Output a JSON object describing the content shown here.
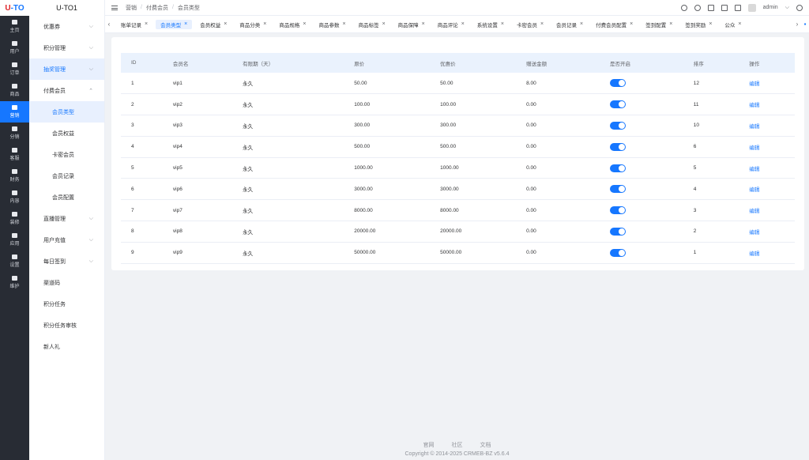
{
  "logo": {
    "part1": "U",
    "part2": "-",
    "part3": "TO"
  },
  "rail": [
    {
      "label": "主页",
      "icon": "home-icon"
    },
    {
      "label": "用户",
      "icon": "user-icon"
    },
    {
      "label": "订单",
      "icon": "order-icon"
    },
    {
      "label": "商品",
      "icon": "product-icon"
    },
    {
      "label": "营销",
      "icon": "marketing-icon",
      "active": true
    },
    {
      "label": "分销",
      "icon": "distribution-icon"
    },
    {
      "label": "客服",
      "icon": "service-icon"
    },
    {
      "label": "财务",
      "icon": "finance-icon"
    },
    {
      "label": "内容",
      "icon": "content-icon"
    },
    {
      "label": "装修",
      "icon": "decoration-icon"
    },
    {
      "label": "应用",
      "icon": "apps-icon"
    },
    {
      "label": "设置",
      "icon": "settings-icon"
    },
    {
      "label": "维护",
      "icon": "maintain-icon"
    }
  ],
  "app_title": "U-TO1",
  "submenu": [
    {
      "label": "优惠券",
      "arrow": "⌵"
    },
    {
      "label": "积分管理",
      "arrow": "⌵"
    },
    {
      "label": "抽奖管理",
      "arrow": "⌵",
      "hl": true
    },
    {
      "label": "付费会员",
      "arrow": "⌃"
    },
    {
      "label": "会员类型",
      "sub": true,
      "selected": true
    },
    {
      "label": "会员权益",
      "sub": true
    },
    {
      "label": "卡密会员",
      "sub": true
    },
    {
      "label": "会员记录",
      "sub": true
    },
    {
      "label": "会员配置",
      "sub": true
    },
    {
      "label": "直播管理",
      "arrow": "⌵"
    },
    {
      "label": "用户充值",
      "arrow": "⌵"
    },
    {
      "label": "每日签到",
      "arrow": "⌵"
    },
    {
      "label": "渠道码"
    },
    {
      "label": "积分任务"
    },
    {
      "label": "积分任务审核"
    },
    {
      "label": "新人礼"
    }
  ],
  "breadcrumb": [
    "营销",
    "付费会员",
    "会员类型"
  ],
  "header": {
    "user": "admin",
    "user_caret": "⌵"
  },
  "tab_nav": {
    "prev": "‹",
    "next": "›"
  },
  "tabs": [
    {
      "label": "账单记录"
    },
    {
      "label": "会员类型",
      "active": true
    },
    {
      "label": "会员权益"
    },
    {
      "label": "商品分类"
    },
    {
      "label": "商品规格"
    },
    {
      "label": "商品参数"
    },
    {
      "label": "商品标签"
    },
    {
      "label": "商品保障"
    },
    {
      "label": "商品评论"
    },
    {
      "label": "系统设置"
    },
    {
      "label": "卡密会员"
    },
    {
      "label": "会员记录"
    },
    {
      "label": "付费会员配置"
    },
    {
      "label": "签到配置"
    },
    {
      "label": "签到奖励"
    },
    {
      "label": "公众"
    }
  ],
  "table": {
    "columns": [
      "ID",
      "会员名",
      "有限期（天）",
      "原价",
      "优惠价",
      "赠送金额",
      "是否开启",
      "排序",
      "操作"
    ],
    "action_label": "编辑",
    "rows": [
      {
        "id": "1",
        "name": "vip1",
        "period": "永久",
        "price": "50.00",
        "discount": "50.00",
        "gift": "8.00",
        "on": true,
        "sort": "12"
      },
      {
        "id": "2",
        "name": "vip2",
        "period": "永久",
        "price": "100.00",
        "discount": "100.00",
        "gift": "0.00",
        "on": true,
        "sort": "11"
      },
      {
        "id": "3",
        "name": "vip3",
        "period": "永久",
        "price": "300.00",
        "discount": "300.00",
        "gift": "0.00",
        "on": true,
        "sort": "10"
      },
      {
        "id": "4",
        "name": "vip4",
        "period": "永久",
        "price": "500.00",
        "discount": "500.00",
        "gift": "0.00",
        "on": true,
        "sort": "6"
      },
      {
        "id": "5",
        "name": "vip5",
        "period": "永久",
        "price": "1000.00",
        "discount": "1000.00",
        "gift": "0.00",
        "on": true,
        "sort": "5"
      },
      {
        "id": "6",
        "name": "vip6",
        "period": "永久",
        "price": "3000.00",
        "discount": "3000.00",
        "gift": "0.00",
        "on": true,
        "sort": "4"
      },
      {
        "id": "7",
        "name": "vip7",
        "period": "永久",
        "price": "8000.00",
        "discount": "8000.00",
        "gift": "0.00",
        "on": true,
        "sort": "3"
      },
      {
        "id": "8",
        "name": "vip8",
        "period": "永久",
        "price": "20000.00",
        "discount": "20000.00",
        "gift": "0.00",
        "on": true,
        "sort": "2"
      },
      {
        "id": "9",
        "name": "vip9",
        "period": "永久",
        "price": "50000.00",
        "discount": "50000.00",
        "gift": "0.00",
        "on": true,
        "sort": "1"
      }
    ]
  },
  "footer": {
    "links": [
      "官网",
      "社区",
      "文档"
    ],
    "copyright": "Copyright © 2014-2025 CRMEB-BZ v5.6.4"
  },
  "colors": {
    "accent": "#1677ff",
    "rail_bg": "#282c34"
  }
}
